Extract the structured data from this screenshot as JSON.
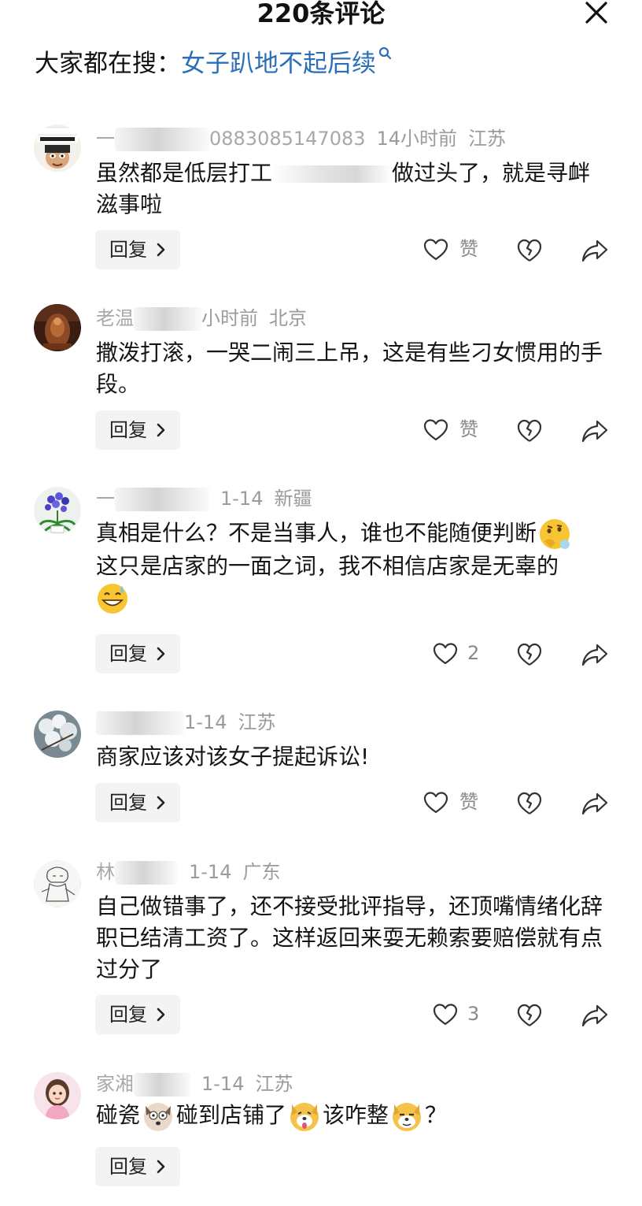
{
  "header": {
    "title": "220条评论"
  },
  "search": {
    "prefix": "大家都在搜：",
    "link": "女子趴地不起后续"
  },
  "comments": [
    {
      "name_start": "一",
      "name_end": "0883085147083",
      "time": "14小时前",
      "location": "江苏",
      "text_a": "虽然都是低层打工",
      "text_b": "做过头了，就是寻衅滋事啦",
      "like_label": "赞",
      "reply_label": "回复"
    },
    {
      "name_start": "老温",
      "time": "小时前",
      "location": "北京",
      "text": "撒泼打滚，一哭二闹三上吊，这是有些刁女惯用的手段。",
      "like_label": "赞",
      "reply_label": "回复"
    },
    {
      "name_start": "一",
      "time": "1-14",
      "location": "新疆",
      "text_a": "真相是什么？不是当事人，谁也不能随便判断",
      "text_b": "这只是店家的一面之词，我不相信店家是无辜的",
      "like_label": "2",
      "reply_label": "回复"
    },
    {
      "name_start": "",
      "time": "1-14",
      "location": "江苏",
      "text": "商家应该对该女子提起诉讼!",
      "like_label": "赞",
      "reply_label": "回复"
    },
    {
      "name_start": "林",
      "time": "1-14",
      "location": "广东",
      "text": "自己做错事了，还不接受批评指导，还顶嘴情绪化辞职已结清工资了。这样返回来耍无赖索要赔偿就有点过分了",
      "like_label": "3",
      "reply_label": "回复"
    },
    {
      "name_start": "家湘",
      "time": "1-14",
      "location": "江苏",
      "seg1": "碰瓷",
      "seg2": "碰到店铺了",
      "seg3": "该咋整",
      "seg4": "？",
      "reply_label": "回复"
    }
  ],
  "colors": {
    "link": "#2a6fb8",
    "meta": "#9b9b9b",
    "reply_bg": "#f3f3f3"
  }
}
